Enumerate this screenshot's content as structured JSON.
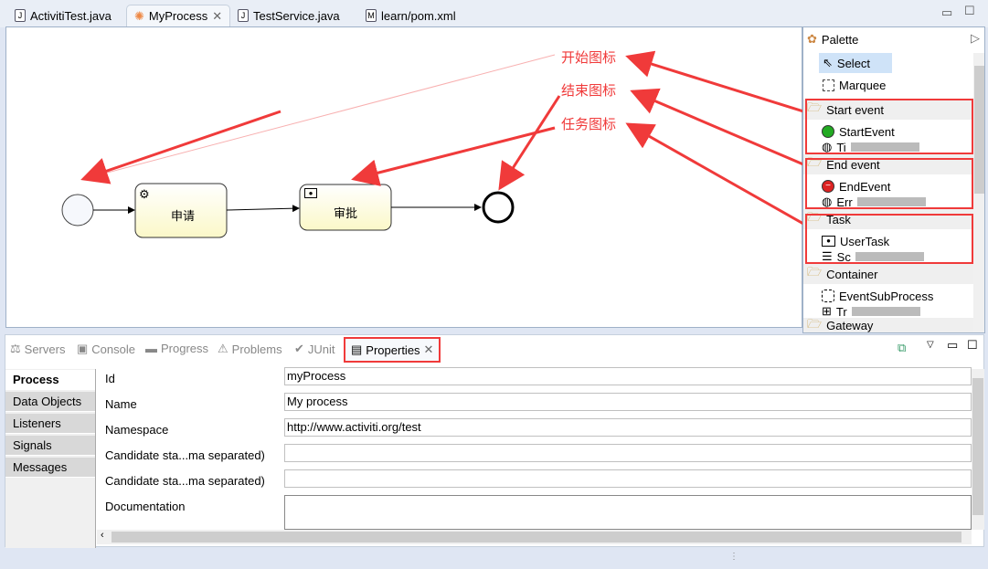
{
  "editor_tabs": [
    {
      "label": "ActivitiTest.java",
      "icon": "java-file-icon"
    },
    {
      "label": "MyProcess",
      "icon": "process-icon",
      "active": true
    },
    {
      "label": "TestService.java",
      "icon": "java-file-icon"
    },
    {
      "label": "learn/pom.xml",
      "icon": "maven-file-icon"
    }
  ],
  "diagram": {
    "task1": "申请",
    "task2": "审批"
  },
  "annotations": {
    "start": "开始图标",
    "end": "结束图标",
    "task": "任务图标",
    "color": "#f03a3a"
  },
  "palette": {
    "title": "Palette",
    "select": "Select",
    "marquee": "Marquee",
    "groups": [
      {
        "label": "Start event",
        "items": [
          "StartEvent",
          "Ti"
        ]
      },
      {
        "label": "End event",
        "items": [
          "EndEvent",
          "Err"
        ]
      },
      {
        "label": "Task",
        "items": [
          "UserTask",
          "Sc"
        ]
      },
      {
        "label": "Container",
        "items": [
          "EventSubProcess",
          "Tr"
        ]
      },
      {
        "label": "Gateway",
        "items": []
      }
    ]
  },
  "bottom_tabs": [
    "Servers",
    "Console",
    "Progress",
    "Problems",
    "JUnit",
    "Properties"
  ],
  "side_tabs": [
    "Process",
    "Data Objects",
    "Listeners",
    "Signals",
    "Messages"
  ],
  "fields": [
    {
      "label": "Id",
      "value": "myProcess"
    },
    {
      "label": "Name",
      "value": "My process"
    },
    {
      "label": "Namespace",
      "value": "http://www.activiti.org/test"
    },
    {
      "label": "Candidate sta...ma separated)",
      "value": ""
    },
    {
      "label": "Candidate sta...ma separated)",
      "value": ""
    },
    {
      "label": "Documentation",
      "value": ""
    }
  ]
}
